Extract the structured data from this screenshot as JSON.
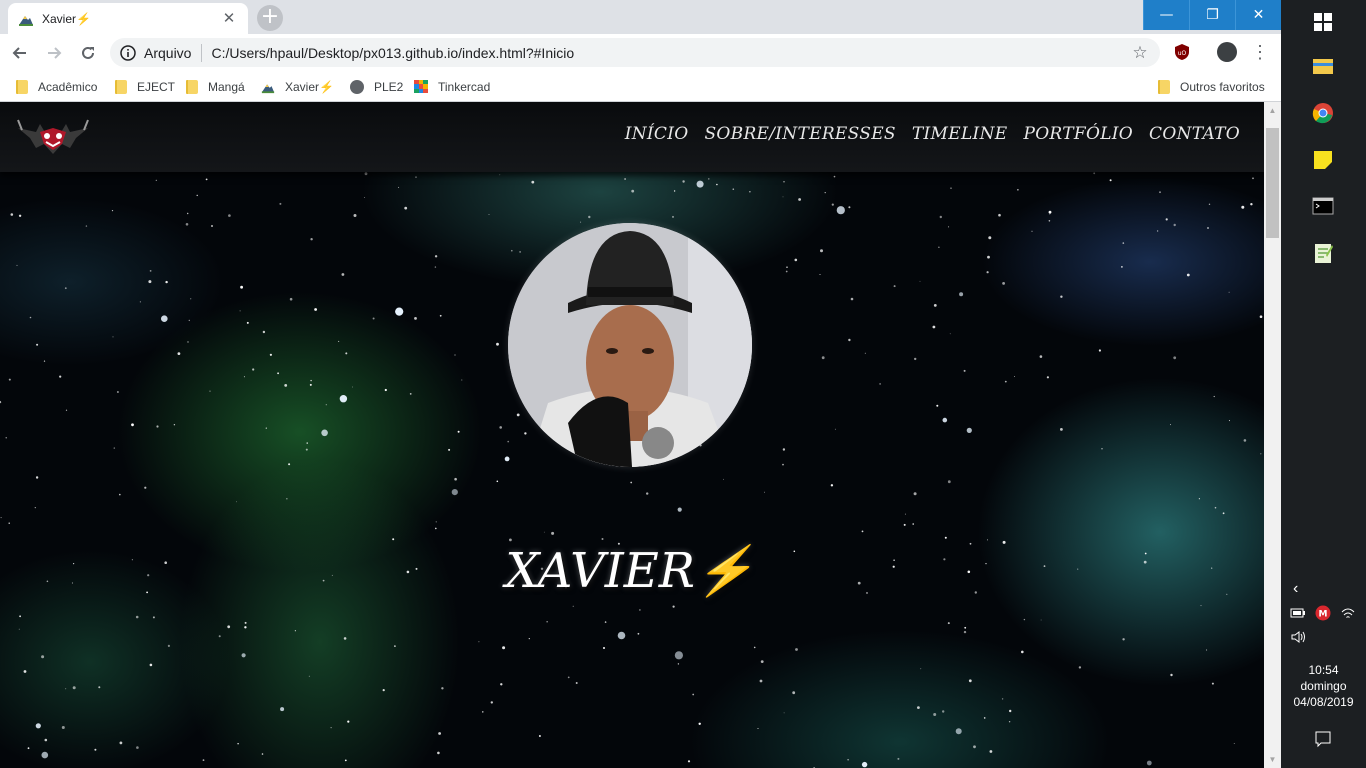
{
  "browser": {
    "tab": {
      "title": "Xavier⚡",
      "favicon": "mountain-sun-icon",
      "close_label": "✕"
    },
    "new_tab_label": "+",
    "window_controls": {
      "minimize": "—",
      "restore": "❐",
      "close": "✕"
    },
    "address_bar": {
      "scheme_label": "Arquivo",
      "url": "C:/Users/hpaul/Desktop/px013.github.io/index.html?#Inicio"
    },
    "bookmarks": [
      {
        "label": "Acadêmico",
        "icon": "folder-icon"
      },
      {
        "label": "EJECT",
        "icon": "folder-icon"
      },
      {
        "label": "Mangá",
        "icon": "folder-icon"
      },
      {
        "label": "Xavier⚡",
        "icon": "mountain-sun-icon"
      },
      {
        "label": "PLE2",
        "icon": "globe-icon"
      },
      {
        "label": "Tinkercad",
        "icon": "tinkercad-icon"
      }
    ],
    "other_bookmarks": "Outros favoritos"
  },
  "site": {
    "nav": [
      "INÍCIO",
      "SOBRE/INTERESSES",
      "TIMELINE",
      "PORTFÓLIO",
      "CONTATO"
    ],
    "hero_title": "XAVIER⚡"
  },
  "taskbar": {
    "apps": [
      "windows-start-icon",
      "file-explorer-icon",
      "chrome-icon",
      "sticky-notes-icon",
      "command-prompt-icon",
      "notepad-plus-icon"
    ],
    "time": "10:54",
    "day": "domingo",
    "date": "04/08/2019"
  },
  "colors": {
    "accent_window": "#1f7fc9",
    "nav_text": "#e8e8e8",
    "space_bg": "#03060a",
    "taskbar": "#1c1f22"
  }
}
